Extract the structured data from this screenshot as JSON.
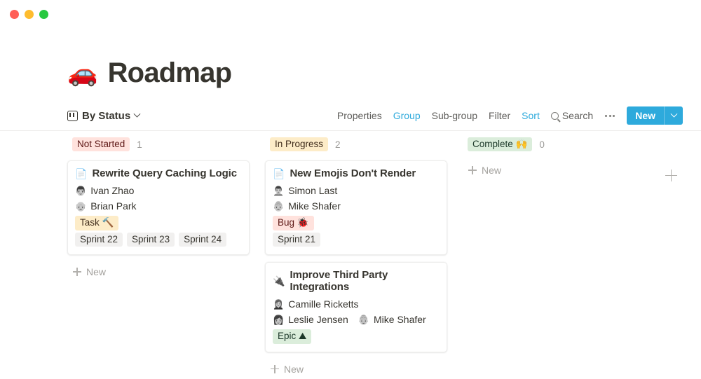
{
  "window": {
    "traffic_lights": [
      {
        "name": "close",
        "color": "#ff5f57"
      },
      {
        "name": "minimize",
        "color": "#febc2e"
      },
      {
        "name": "maximize",
        "color": "#28c840"
      }
    ]
  },
  "header": {
    "emoji": "🚗",
    "title": "Roadmap"
  },
  "viewbar": {
    "view_name": "By Status",
    "view_icon": "board-icon",
    "tools": [
      {
        "label": "Properties",
        "active": false
      },
      {
        "label": "Group",
        "active": true
      },
      {
        "label": "Sub-group",
        "active": false
      },
      {
        "label": "Filter",
        "active": false
      },
      {
        "label": "Sort",
        "active": true
      }
    ],
    "search_label": "Search",
    "more_label": "•••",
    "new_label": "New"
  },
  "board": {
    "add_group_label": "+",
    "new_item_label": "New",
    "columns": [
      {
        "name": "Not Started",
        "pill_class": "pill-notstarted",
        "pill_bg": "#ffe2dd",
        "pill_fg": "#5d1715",
        "count": "1",
        "cards": [
          {
            "icon": "📄",
            "icon_name": "page-icon",
            "title": "Rewrite Query Caching Logic",
            "people": [
              {
                "avatar": "👨",
                "name": "Ivan Zhao"
              },
              {
                "avatar": "👴",
                "name": "Brian Park"
              }
            ],
            "people_rows": [
              [
                0
              ],
              [
                1
              ]
            ],
            "tags": [
              {
                "label": "Task 🔨",
                "class": "tag-task"
              }
            ],
            "sprints": [
              {
                "label": "Sprint 22"
              },
              {
                "label": "Sprint 23"
              },
              {
                "label": "Sprint 24"
              }
            ]
          }
        ]
      },
      {
        "name": "In Progress",
        "pill_class": "pill-inprogress",
        "pill_bg": "#fdecc8",
        "pill_fg": "#402c1b",
        "count": "2",
        "cards": [
          {
            "icon": "📄",
            "icon_name": "page-icon",
            "title": "New Emojis Don't Render",
            "people": [
              {
                "avatar": "👨‍🦱",
                "name": "Simon Last"
              },
              {
                "avatar": "👵",
                "name": "Mike Shafer"
              }
            ],
            "people_rows": [
              [
                0
              ],
              [
                1
              ]
            ],
            "tags": [
              {
                "label": "Bug 🐞",
                "class": "tag-bug"
              }
            ],
            "sprints": [
              {
                "label": "Sprint 21"
              }
            ]
          },
          {
            "icon": "🔌",
            "icon_name": "plug-icon",
            "title": "Improve Third Party Integrations",
            "people": [
              {
                "avatar": "👩‍🦰",
                "name": "Camille Ricketts"
              },
              {
                "avatar": "👩",
                "name": "Leslie Jensen"
              },
              {
                "avatar": "👵",
                "name": "Mike Shafer"
              }
            ],
            "people_rows": [
              [
                0
              ],
              [
                1,
                2
              ]
            ],
            "tags": [
              {
                "label": "Epic ⛰",
                "class": "tag-epic"
              }
            ],
            "sprints": []
          }
        ]
      },
      {
        "name": "Complete 🙌",
        "pill_class": "pill-complete",
        "pill_bg": "#dbeddb",
        "pill_fg": "#1c3829",
        "count": "0",
        "cards": []
      }
    ]
  }
}
